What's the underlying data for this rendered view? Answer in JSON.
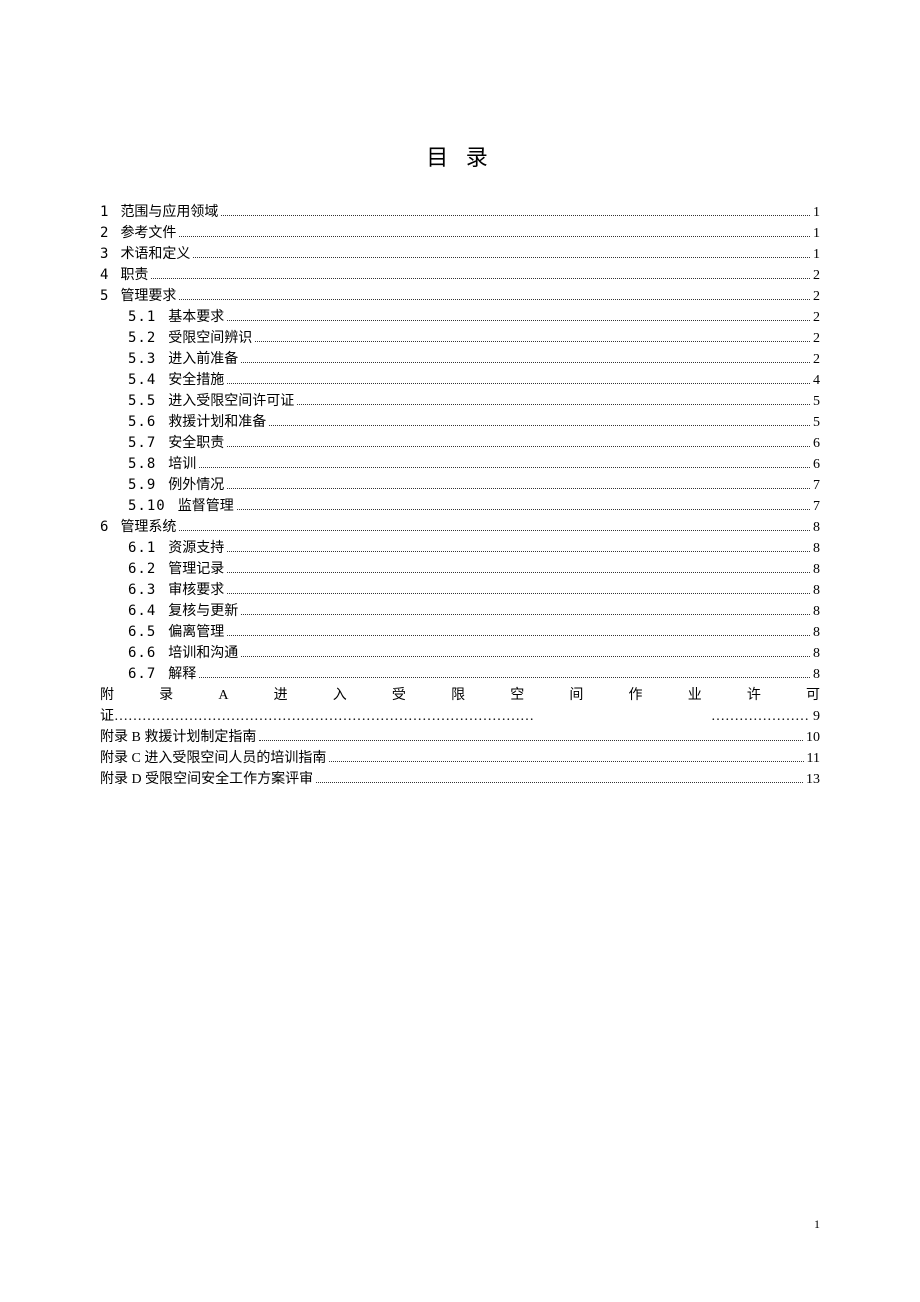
{
  "title": "目 录",
  "toc": [
    {
      "num": "1",
      "label": "范围与应用领域",
      "page": "1",
      "level": 1
    },
    {
      "num": "2",
      "label": "参考文件",
      "page": "1",
      "level": 1
    },
    {
      "num": "3",
      "label": "术语和定义",
      "page": "1",
      "level": 1
    },
    {
      "num": "4",
      "label": "职责",
      "page": "2",
      "level": 1
    },
    {
      "num": "5",
      "label": "管理要求",
      "page": "2",
      "level": 1
    },
    {
      "num": "5.1",
      "label": "基本要求",
      "page": "2",
      "level": 2
    },
    {
      "num": "5.2",
      "label": "受限空间辨识",
      "page": "2",
      "level": 2
    },
    {
      "num": "5.3",
      "label": "进入前准备",
      "page": "2",
      "level": 2
    },
    {
      "num": "5.4",
      "label": "安全措施",
      "page": "4",
      "level": 2
    },
    {
      "num": "5.5",
      "label": "进入受限空间许可证",
      "page": "5",
      "level": 2
    },
    {
      "num": "5.6",
      "label": "救援计划和准备",
      "page": "5",
      "level": 2
    },
    {
      "num": "5.7",
      "label": "安全职责",
      "page": "6",
      "level": 2
    },
    {
      "num": "5.8",
      "label": "培训",
      "page": "6",
      "level": 2
    },
    {
      "num": "5.9",
      "label": "例外情况",
      "page": "7",
      "level": 2
    },
    {
      "num": "5.10",
      "label": "监督管理",
      "page": "7",
      "level": 2
    },
    {
      "num": "6",
      "label": "管理系统",
      "page": "8",
      "level": 1
    },
    {
      "num": "6.1",
      "label": "资源支持",
      "page": "8",
      "level": 2
    },
    {
      "num": "6.2",
      "label": "管理记录",
      "page": "8",
      "level": 2
    },
    {
      "num": "6.3",
      "label": "审核要求",
      "page": "8",
      "level": 2
    },
    {
      "num": "6.4",
      "label": "复核与更新",
      "page": "8",
      "level": 2
    },
    {
      "num": "6.5",
      "label": "偏离管理",
      "page": "8",
      "level": 2
    },
    {
      "num": "6.6",
      "label": "培训和沟通",
      "page": "8",
      "level": 2
    },
    {
      "num": "6.7",
      "label": "解释",
      "page": "8",
      "level": 2
    }
  ],
  "appendix_a": {
    "chars": [
      "附",
      "录",
      "A",
      "进",
      "入",
      "受",
      "限",
      "空",
      "间",
      "作",
      "业",
      "许",
      "可"
    ],
    "line2_prefix": "证",
    "leader": "………………………………………………………………………………",
    "leader2": "…………………",
    "page": "9"
  },
  "appendices": [
    {
      "label": "附录 B  救援计划制定指南",
      "page": "10"
    },
    {
      "label": "附录 C  进入受限空间人员的培训指南",
      "page": "11"
    },
    {
      "label": "附录 D  受限空间安全工作方案评审",
      "page": "13"
    }
  ],
  "page_number": "1"
}
